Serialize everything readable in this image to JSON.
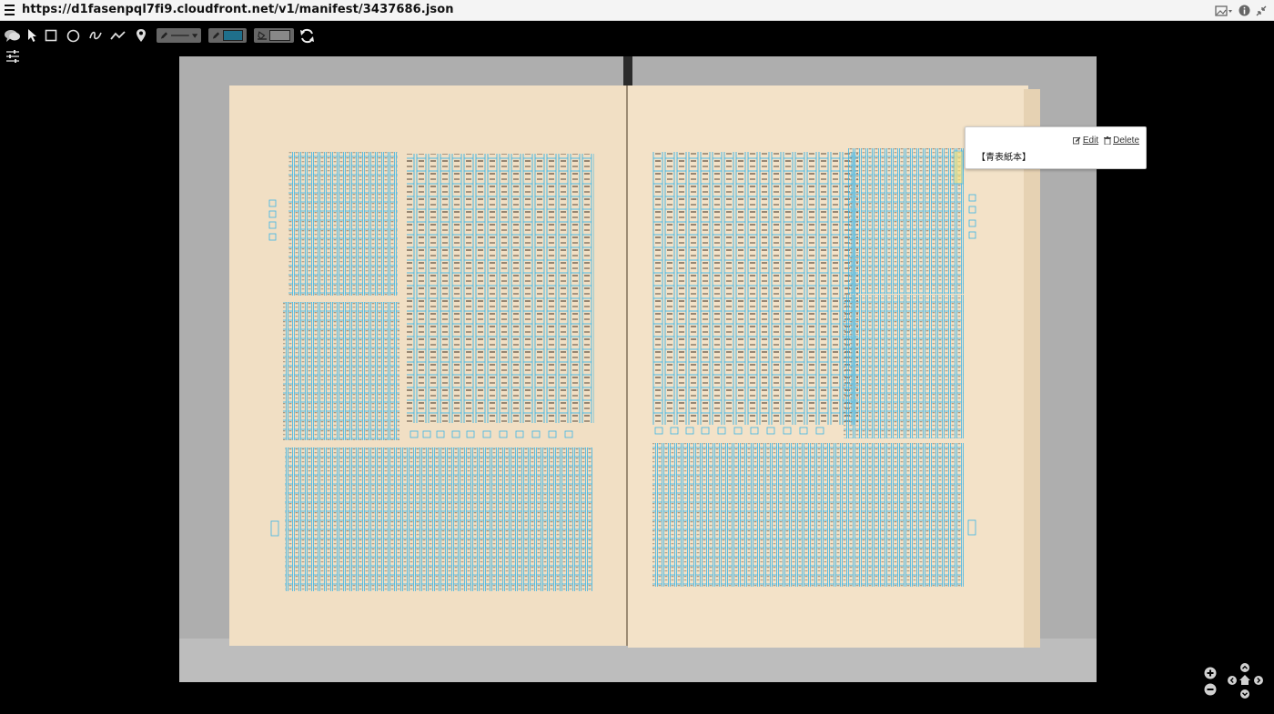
{
  "window": {
    "title": "https://d1fasenpql7fi9.cloudfront.net/v1/manifest/3437686.json"
  },
  "annotation": {
    "edit_label": "Edit",
    "delete_label": "Delete",
    "text": "【青表紙本】"
  },
  "colors": {
    "accent_box": "#3ab4e6",
    "toolbar_bg": "#000000",
    "topbar_bg": "#f4f4f4",
    "paper": "#f1dfc4",
    "line_swatch": "#1f6f8b"
  },
  "icons": {
    "menu": "menu-icon",
    "comment": "comment-icon",
    "pointer": "pointer-icon",
    "rectangle": "rectangle-icon",
    "circle": "circle-icon",
    "freehand": "freehand-icon",
    "polyline": "polyline-icon",
    "pin": "pin-icon",
    "refresh": "refresh-icon",
    "settings": "settings-icon",
    "zoom_in": "zoom-in-icon",
    "zoom_out": "zoom-out-icon",
    "home": "home-icon"
  }
}
